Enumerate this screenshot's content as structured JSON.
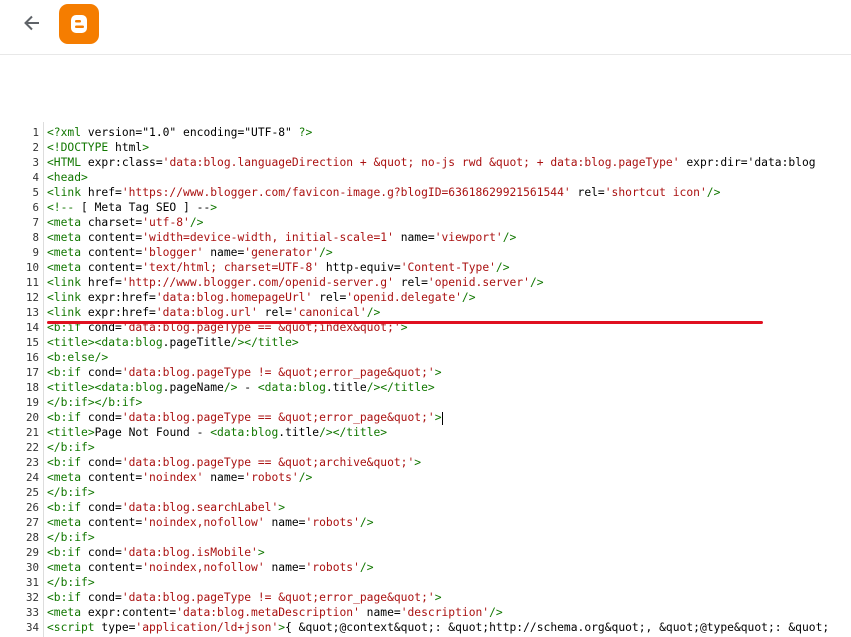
{
  "header": {
    "back_icon": "arrow-left-icon",
    "logo_icon": "blogger-logo-icon",
    "logo_color": "#f57d00"
  },
  "editor": {
    "highlight_color": "#e01020",
    "lines": [
      {
        "n": "1",
        "code": "<?xml version=\"1.0\" encoding=\"UTF-8\" ?>"
      },
      {
        "n": "2",
        "code": "<!DOCTYPE html>"
      },
      {
        "n": "3",
        "code": "<HTML expr:class='data:blog.languageDirection + &quot; no-js rwd &quot; + data:blog.pageType' expr:dir='data:blog"
      },
      {
        "n": "4",
        "code": "<head>"
      },
      {
        "n": "5",
        "code": "<link href='https://www.blogger.com/favicon-image.g?blogID=63618629921561544' rel='shortcut icon'/>"
      },
      {
        "n": "6",
        "code": "<!-- [ Meta Tag SEO ] -->"
      },
      {
        "n": "7",
        "code": "<meta charset='utf-8'/>"
      },
      {
        "n": "8",
        "code": "<meta content='width=device-width, initial-scale=1' name='viewport'/>"
      },
      {
        "n": "9",
        "code": "<meta content='blogger' name='generator'/>"
      },
      {
        "n": "10",
        "code": "<meta content='text/html; charset=UTF-8' http-equiv='Content-Type'/>"
      },
      {
        "n": "11",
        "code": "<link href='http://www.blogger.com/openid-server.g' rel='openid.server'/>"
      },
      {
        "n": "12",
        "code": "<link expr:href='data:blog.homepageUrl' rel='openid.delegate'/>"
      },
      {
        "n": "13",
        "code": "<link expr:href='data:blog.url' rel='canonical'/>"
      },
      {
        "n": "14",
        "code": "<b:if cond='data:blog.pageType == &quot;index&quot;'>"
      },
      {
        "n": "15",
        "code": "<title><data:blog.pageTitle/></title>"
      },
      {
        "n": "16",
        "code": "<b:else/>"
      },
      {
        "n": "17",
        "code": "<b:if cond='data:blog.pageType != &quot;error_page&quot;'>"
      },
      {
        "n": "18",
        "code": "<title><data:blog.pageName/> - <data:blog.title/></title>"
      },
      {
        "n": "19",
        "code": "</b:if></b:if>"
      },
      {
        "n": "20",
        "code": "<b:if cond='data:blog.pageType == &quot;error_page&quot;'>"
      },
      {
        "n": "21",
        "code": "<title>Page Not Found - <data:blog.title/></title>"
      },
      {
        "n": "22",
        "code": "</b:if>"
      },
      {
        "n": "23",
        "code": "<b:if cond='data:blog.pageType == &quot;archive&quot;'>"
      },
      {
        "n": "24",
        "code": "<meta content='noindex' name='robots'/>"
      },
      {
        "n": "25",
        "code": "</b:if>"
      },
      {
        "n": "26",
        "code": "<b:if cond='data:blog.searchLabel'>"
      },
      {
        "n": "27",
        "code": "<meta content='noindex,nofollow' name='robots'/>"
      },
      {
        "n": "28",
        "code": "</b:if>"
      },
      {
        "n": "29",
        "code": "<b:if cond='data:blog.isMobile'>"
      },
      {
        "n": "30",
        "code": "<meta content='noindex,nofollow' name='robots'/>"
      },
      {
        "n": "31",
        "code": "</b:if>"
      },
      {
        "n": "32",
        "code": "<b:if cond='data:blog.pageType != &quot;error_page&quot;'>"
      },
      {
        "n": "33",
        "code": "<meta expr:content='data:blog.metaDescription' name='description'/>"
      },
      {
        "n": "34",
        "code": "<script type='application/ld+json'>{ &quot;@context&quot;: &quot;http://schema.org&quot;, &quot;@type&quot;: &quot;"
      }
    ]
  }
}
